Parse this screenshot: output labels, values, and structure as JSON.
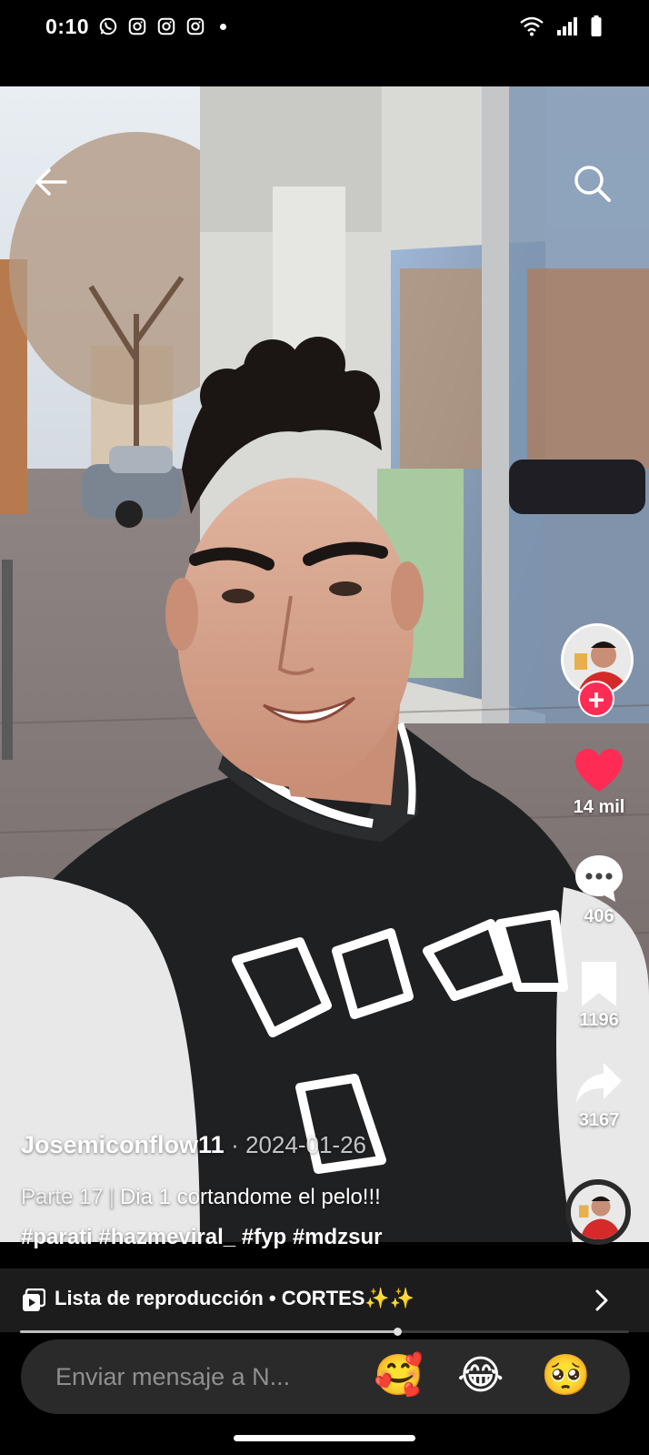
{
  "status_bar": {
    "time": "0:10",
    "notification_icons": [
      "whatsapp-icon",
      "instagram-icon",
      "instagram-icon",
      "instagram-icon"
    ],
    "system_icons": [
      "wifi-icon",
      "signal-icon",
      "battery-icon"
    ]
  },
  "top_bar": {
    "back_icon": "arrow-left-icon",
    "search_icon": "search-icon"
  },
  "actions": {
    "likes": "14 mil",
    "comments": "406",
    "saves": "1196",
    "shares": "3167",
    "follow_label": "+"
  },
  "post": {
    "author": "Josemiconflow11",
    "date": "· 2024-01-26",
    "part": "Parte 17",
    "separator": "|",
    "caption": "Dia 1 cortandome el pelo!!!",
    "hashtags": "#parati #hazmeviral_ #fyp #mdzsur"
  },
  "playlist": {
    "label": "Lista de reproducción • CORTES✨✨",
    "progress_fraction": 0.62
  },
  "comment_bar": {
    "placeholder": "Enviar mensaje a N...",
    "emojis": [
      "🥰",
      "😂",
      "🥺"
    ]
  },
  "colors": {
    "accent": "#fe2c55",
    "background": "#000000",
    "input": "#2a2a2a"
  }
}
